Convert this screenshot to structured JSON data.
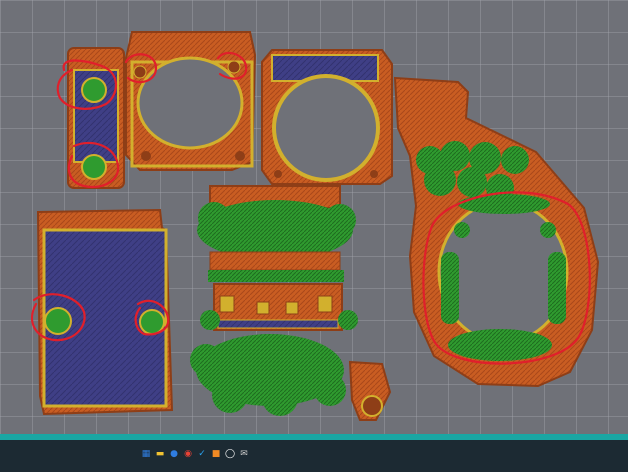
{
  "app": {
    "type": "3d-slicer-preview",
    "status": "layer preview"
  },
  "colors": {
    "background": "#6f7178",
    "grid": "#c9ccd3",
    "orange": "#c95d22",
    "orange_dark": "#8e3e17",
    "green": "#2f9b2f",
    "green_dark": "#1e6d1f",
    "blue": "#3f3f86",
    "yellow_edge": "#d2b02d",
    "annotation_red": "#e01f2b",
    "taskbar": "#1c2a33",
    "taskbar_accent": "#1aa6a3"
  },
  "taskbar": {
    "icons": [
      {
        "name": "windows-start-icon",
        "glyph": "▦",
        "color": "#2f7de1"
      },
      {
        "name": "file-explorer-icon",
        "glyph": "▬",
        "color": "#f1c232"
      },
      {
        "name": "browser-icon",
        "glyph": "●",
        "color": "#2f7de1"
      },
      {
        "name": "chrome-icon",
        "glyph": "◉",
        "color": "#e94235"
      },
      {
        "name": "vscode-icon",
        "glyph": "✓",
        "color": "#2aa3f0"
      },
      {
        "name": "bambu-studio-icon",
        "glyph": "■",
        "color": "#f08a24"
      },
      {
        "name": "github-icon",
        "glyph": "◯",
        "color": "#ffffff"
      },
      {
        "name": "mail-icon",
        "glyph": "✉",
        "color": "#c9c9c9"
      }
    ]
  },
  "parts": [
    {
      "name": "bracket-left-vertical"
    },
    {
      "name": "fan-mount-large"
    },
    {
      "name": "fan-shroud-square"
    },
    {
      "name": "curved-duct"
    },
    {
      "name": "blue-plate-rectangular"
    },
    {
      "name": "center-assembly-with-supports"
    }
  ],
  "annotations": [
    {
      "name": "circle-annotation-1"
    },
    {
      "name": "circle-annotation-2"
    },
    {
      "name": "circle-annotation-3"
    },
    {
      "name": "circle-annotation-4"
    },
    {
      "name": "circle-annotation-5"
    },
    {
      "name": "circle-annotation-6"
    },
    {
      "name": "oval-annotation-duct"
    }
  ]
}
